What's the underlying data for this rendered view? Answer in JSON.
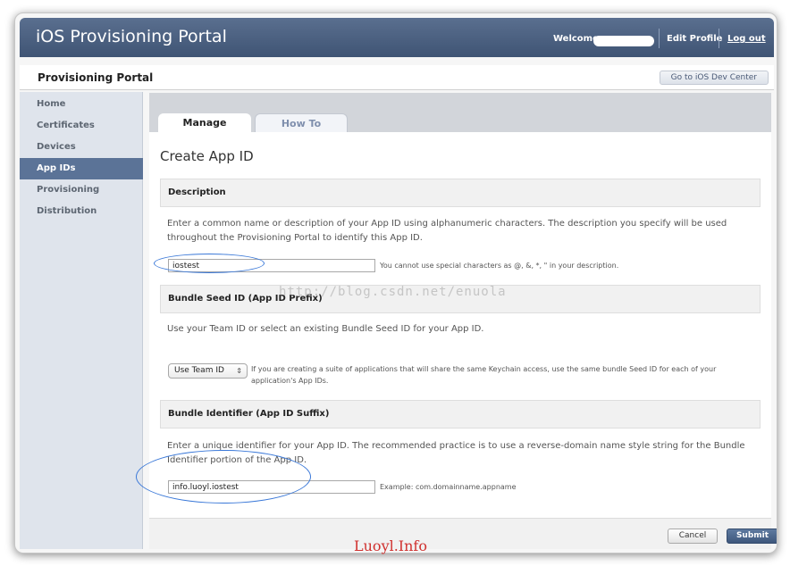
{
  "topbar": {
    "title": "iOS Provisioning Portal",
    "welcome": "Welcome,",
    "edit_profile": "Edit Profile",
    "logout": "Log out"
  },
  "header": {
    "portal_title": "Provisioning Portal",
    "dev_center_button": "Go to iOS Dev Center"
  },
  "sidebar": {
    "items": [
      {
        "label": "Home",
        "active": false
      },
      {
        "label": "Certificates",
        "active": false
      },
      {
        "label": "Devices",
        "active": false
      },
      {
        "label": "App IDs",
        "active": true
      },
      {
        "label": "Provisioning",
        "active": false
      },
      {
        "label": "Distribution",
        "active": false
      }
    ]
  },
  "tabs": [
    {
      "label": "Manage",
      "active": true
    },
    {
      "label": "How To",
      "active": false
    }
  ],
  "main": {
    "page_title": "Create App ID",
    "description": {
      "heading": "Description",
      "text": "Enter a common name or description of your App ID using alphanumeric characters. The description you specify will be used throughout the Provisioning Portal to identify this App ID.",
      "value": "iostest",
      "hint": "You cannot use special characters as @, &, *, \" in your description."
    },
    "seed": {
      "heading": "Bundle Seed ID (App ID Prefix)",
      "text": "Use your Team ID or select an existing Bundle Seed ID for your App ID.",
      "selected": "Use Team ID",
      "hint": "If you are creating a suite of applications that will share the same Keychain access, use the same bundle Seed ID for each of your application's App IDs."
    },
    "bundle": {
      "heading": "Bundle Identifier (App ID Suffix)",
      "text": "Enter a unique identifier for your App ID. The recommended practice is to use a reverse-domain name style string for the Bundle Identifier portion of the App ID.",
      "value": "info.luoyl.iostest",
      "hint": "Example: com.domainname.appname"
    }
  },
  "footer": {
    "cancel": "Cancel",
    "submit": "Submit"
  },
  "overlay": {
    "watermark": "http://blog.csdn.net/enuola",
    "signature": "Luoyl.Info"
  },
  "colors": {
    "topbar": "#4a5f80",
    "sidebar_active": "#5b7397",
    "submit": "#4a6388",
    "annotation": "#3a78d8",
    "signature": "#d0302e"
  }
}
